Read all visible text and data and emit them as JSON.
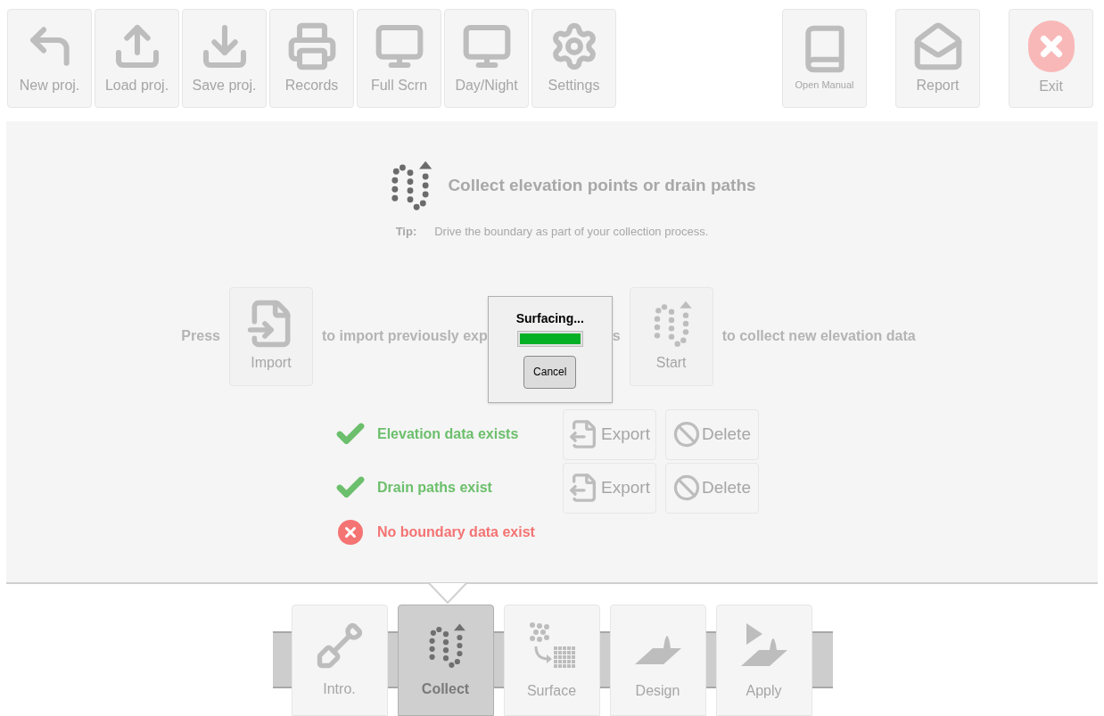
{
  "toolbar": {
    "left": [
      {
        "label": "New proj."
      },
      {
        "label": "Load proj."
      },
      {
        "label": "Save proj."
      },
      {
        "label": "Records"
      },
      {
        "label": "Full Scrn"
      },
      {
        "label": "Day/Night"
      },
      {
        "label": "Settings"
      }
    ],
    "right": [
      {
        "label": "Open Manual"
      },
      {
        "label": "Report"
      },
      {
        "label": "Exit"
      }
    ]
  },
  "heading": "Collect elevation points or drain paths",
  "tip": {
    "label": "Tip:",
    "text": "Drive the boundary as part of your collection process."
  },
  "instruction": {
    "press": "Press",
    "import_button": "Import",
    "import_text_before": "to import previously exp",
    "import_text_after": "s",
    "start_button": "Start",
    "start_text": "to collect new elevation data"
  },
  "status": [
    {
      "text": "Elevation data exists",
      "exists": true,
      "export": "Export",
      "delete": "Delete"
    },
    {
      "text": "Drain paths exist",
      "exists": true,
      "export": "Export",
      "delete": "Delete"
    },
    {
      "text": "No boundary data exist",
      "exists": false
    }
  ],
  "dialog": {
    "title": "Surfacing...",
    "level": 1,
    "cancel": "Cancel"
  },
  "steps": [
    {
      "label": "Intro.",
      "selected": false
    },
    {
      "label": "Collect",
      "selected": true
    },
    {
      "label": "Surface",
      "selected": false
    },
    {
      "label": "Design",
      "selected": false
    },
    {
      "label": "Apply",
      "selected": false
    }
  ]
}
